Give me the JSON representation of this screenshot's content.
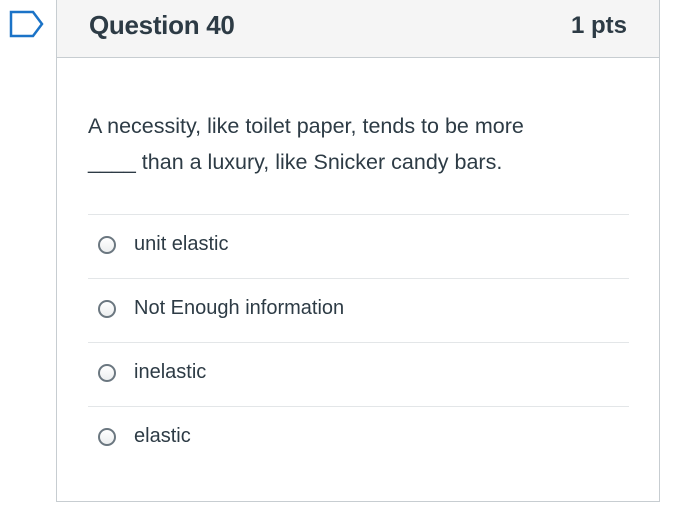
{
  "question": {
    "title": "Question 40",
    "points": "1 pts",
    "text_line1": "A necessity, like toilet paper, tends to be more",
    "text_line2": "____ than a luxury, like Snicker candy bars."
  },
  "answers": [
    {
      "label": "unit elastic",
      "selected": false
    },
    {
      "label": "Not Enough information",
      "selected": false
    },
    {
      "label": "inelastic",
      "selected": false
    },
    {
      "label": "elastic",
      "selected": false
    }
  ],
  "colors": {
    "flag": "#1b73c7",
    "header_bg": "#f5f5f5",
    "border": "#c7cdd1",
    "text": "#2d3b45"
  },
  "icons": {
    "flag": "bookmark-flag-icon",
    "radio": "radio-button-icon"
  }
}
